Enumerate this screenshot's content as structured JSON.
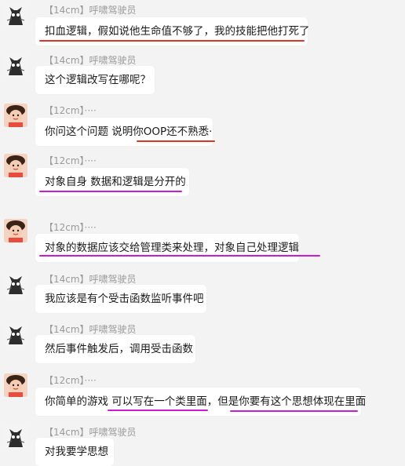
{
  "conversation": [
    {
      "sender": "【14cm】呼啸驾驶员",
      "text": "扣血逻辑，假如说他生命值不够了，我的技能把他打死了",
      "avatar": "cat-avatar"
    },
    {
      "sender": "【14cm】呼啸驾驶员",
      "text": "这个逻辑改写在哪呢？",
      "avatar": "cat-avatar"
    },
    {
      "sender": "【12cm】····",
      "text": "你问这个问题 说明你OOP还不熟悉·",
      "avatar": "kid-avatar"
    },
    {
      "sender": "【12cm】····",
      "text": "对象自身 数据和逻辑是分开的",
      "avatar": "kid-avatar"
    },
    {
      "sender": "【12cm】····",
      "text": "对象的数据应该交给管理类来处理，对象自己处理逻辑",
      "avatar": "kid-avatar"
    },
    {
      "sender": "【14cm】呼啸驾驶员",
      "text": "我应该是有个受击函数监听事件吧",
      "avatar": "cat-avatar"
    },
    {
      "sender": "【14cm】呼啸驾驶员",
      "text": "然后事件触发后，调用受击函数",
      "avatar": "cat-avatar"
    },
    {
      "sender": "【12cm】····",
      "text": "你简单的游戏 可以写在一个类里面，但是你要有这个思想体现在里面",
      "avatar": "kid-avatar"
    },
    {
      "sender": "【14cm】呼啸驾驶员",
      "text": "对我要学思想",
      "avatar": "cat-avatar"
    }
  ],
  "colors": {
    "red_underline": "#e0322a",
    "magenta_underline": "#cc1bd2",
    "bubble": "#ffffff",
    "background": "#f3f3f3"
  }
}
